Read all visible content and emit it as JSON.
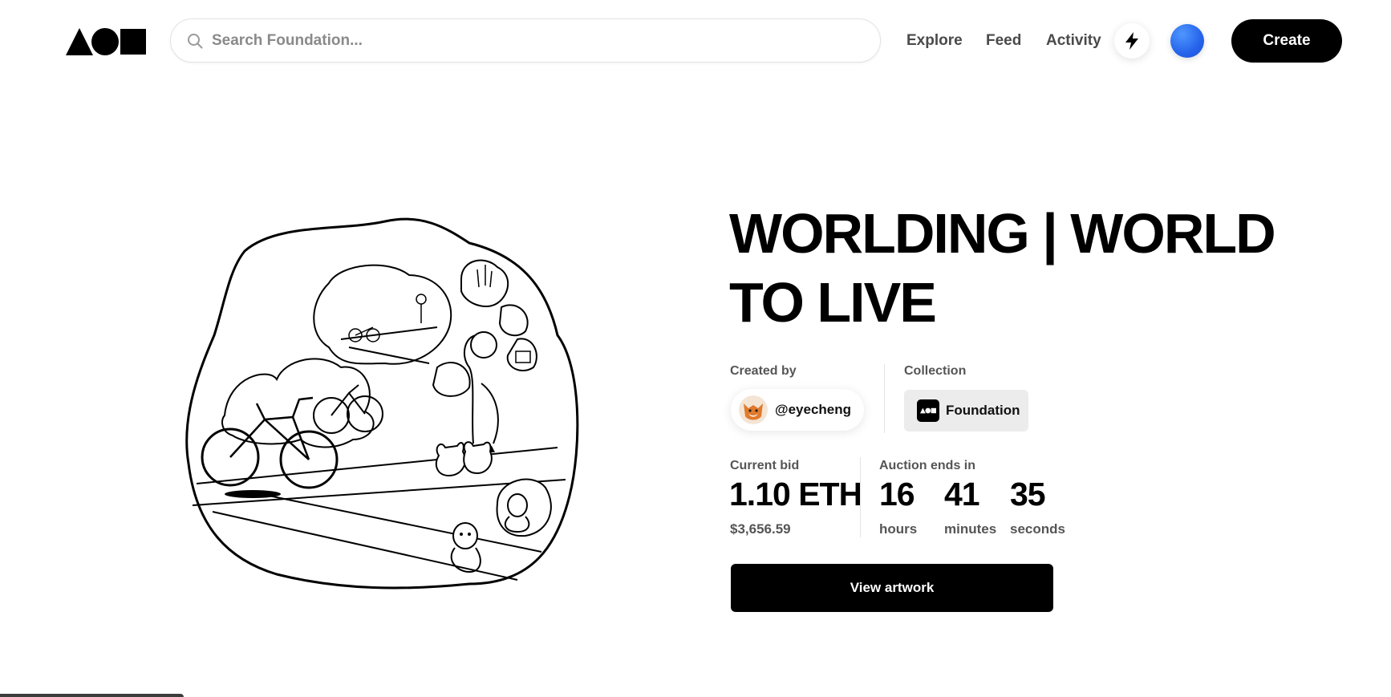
{
  "header": {
    "logo_name": "Foundation logo",
    "search": {
      "placeholder": "Search Foundation...",
      "value": ""
    },
    "nav": [
      {
        "label": "Explore"
      },
      {
        "label": "Feed"
      },
      {
        "label": "Activity"
      }
    ],
    "notifications_icon": "bolt-icon",
    "create_label": "Create"
  },
  "artwork": {
    "title": "WORLDING | WORLD TO LIVE",
    "image_icon": "line-drawing-artwork"
  },
  "creator": {
    "label": "Created by",
    "username": "@eyecheng"
  },
  "collection": {
    "label": "Collection",
    "name": "Foundation"
  },
  "bid": {
    "label": "Current bid",
    "amount": "1.10 ETH",
    "usd": "$3,656.59"
  },
  "auction": {
    "label": "Auction ends in",
    "hours": "16",
    "hours_label": "hours",
    "minutes": "41",
    "minutes_label": "minutes",
    "seconds": "35",
    "seconds_label": "seconds"
  },
  "cta": {
    "label": "View artwork"
  },
  "colors": {
    "accent": "#000000",
    "avatar_blue": "#2563eb",
    "chip_bg": "#ececec"
  }
}
